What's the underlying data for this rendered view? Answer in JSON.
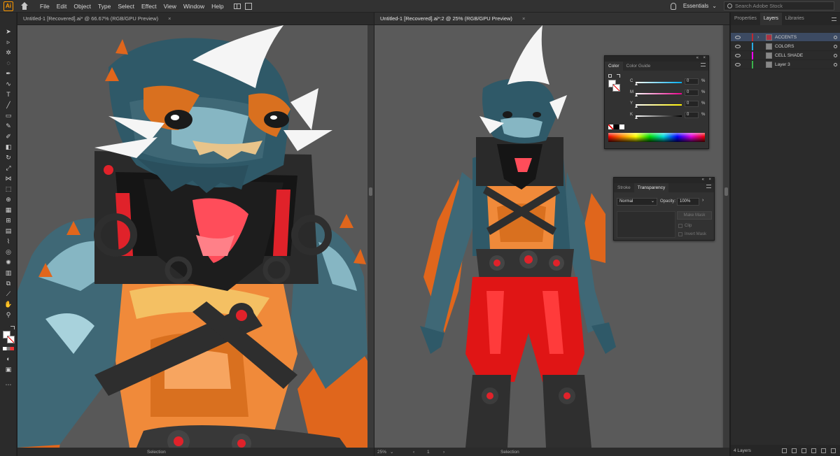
{
  "app": {
    "logo_text": "Ai"
  },
  "menu": [
    "File",
    "Edit",
    "Object",
    "Type",
    "Select",
    "Effect",
    "View",
    "Window",
    "Help"
  ],
  "workspace": {
    "label": "Essentials",
    "chevron": "⌄"
  },
  "search": {
    "placeholder": "Search Adobe Stock"
  },
  "documents": [
    {
      "tab": "Untitled-1 [Recovered].ai* @ 66.67% (RGB/GPU Preview)",
      "close": "×",
      "status_tool": "Selection"
    },
    {
      "tab": "Untitled-1 [Recovered].ai*:2 @ 25% (RGB/GPU Preview)",
      "close": "×",
      "zoom": "25%",
      "artboard": "1",
      "status_tool": "Selection"
    }
  ],
  "color_panel": {
    "tabs": [
      "Color",
      "Color Guide"
    ],
    "channels": [
      {
        "label": "C",
        "value": "0",
        "unit": "%",
        "color": "#00aeef"
      },
      {
        "label": "M",
        "value": "0",
        "unit": "%",
        "color": "#ec008c"
      },
      {
        "label": "Y",
        "value": "0",
        "unit": "%",
        "color": "#fff200"
      },
      {
        "label": "K",
        "value": "0",
        "unit": "%",
        "color": "#888888"
      }
    ]
  },
  "transparency_panel": {
    "tabs": [
      "Stroke",
      "Transparency"
    ],
    "blend_mode": "Normal",
    "opacity_label": "Opacity:",
    "opacity_value": "100%",
    "make_mask": "Make Mask",
    "clip": "Clip",
    "invert_mask": "Invert Mask"
  },
  "right_panel": {
    "tabs": [
      "Properties",
      "Layers",
      "Libraries"
    ],
    "layers": [
      {
        "name": "ACCENTS",
        "color": "#c1272d",
        "selected": true
      },
      {
        "name": "COLORS",
        "color": "#29abe2",
        "selected": false
      },
      {
        "name": "CELL SHADE",
        "color": "#ff00ff",
        "selected": false
      },
      {
        "name": "Layer 3",
        "color": "#39b54a",
        "selected": false
      }
    ],
    "layer_count": "4 Layers"
  },
  "colors": {
    "ui_dark": "#323232",
    "canvas": "#535353",
    "selection": "#3c4a62",
    "accent_orange": "#ff9a00"
  }
}
